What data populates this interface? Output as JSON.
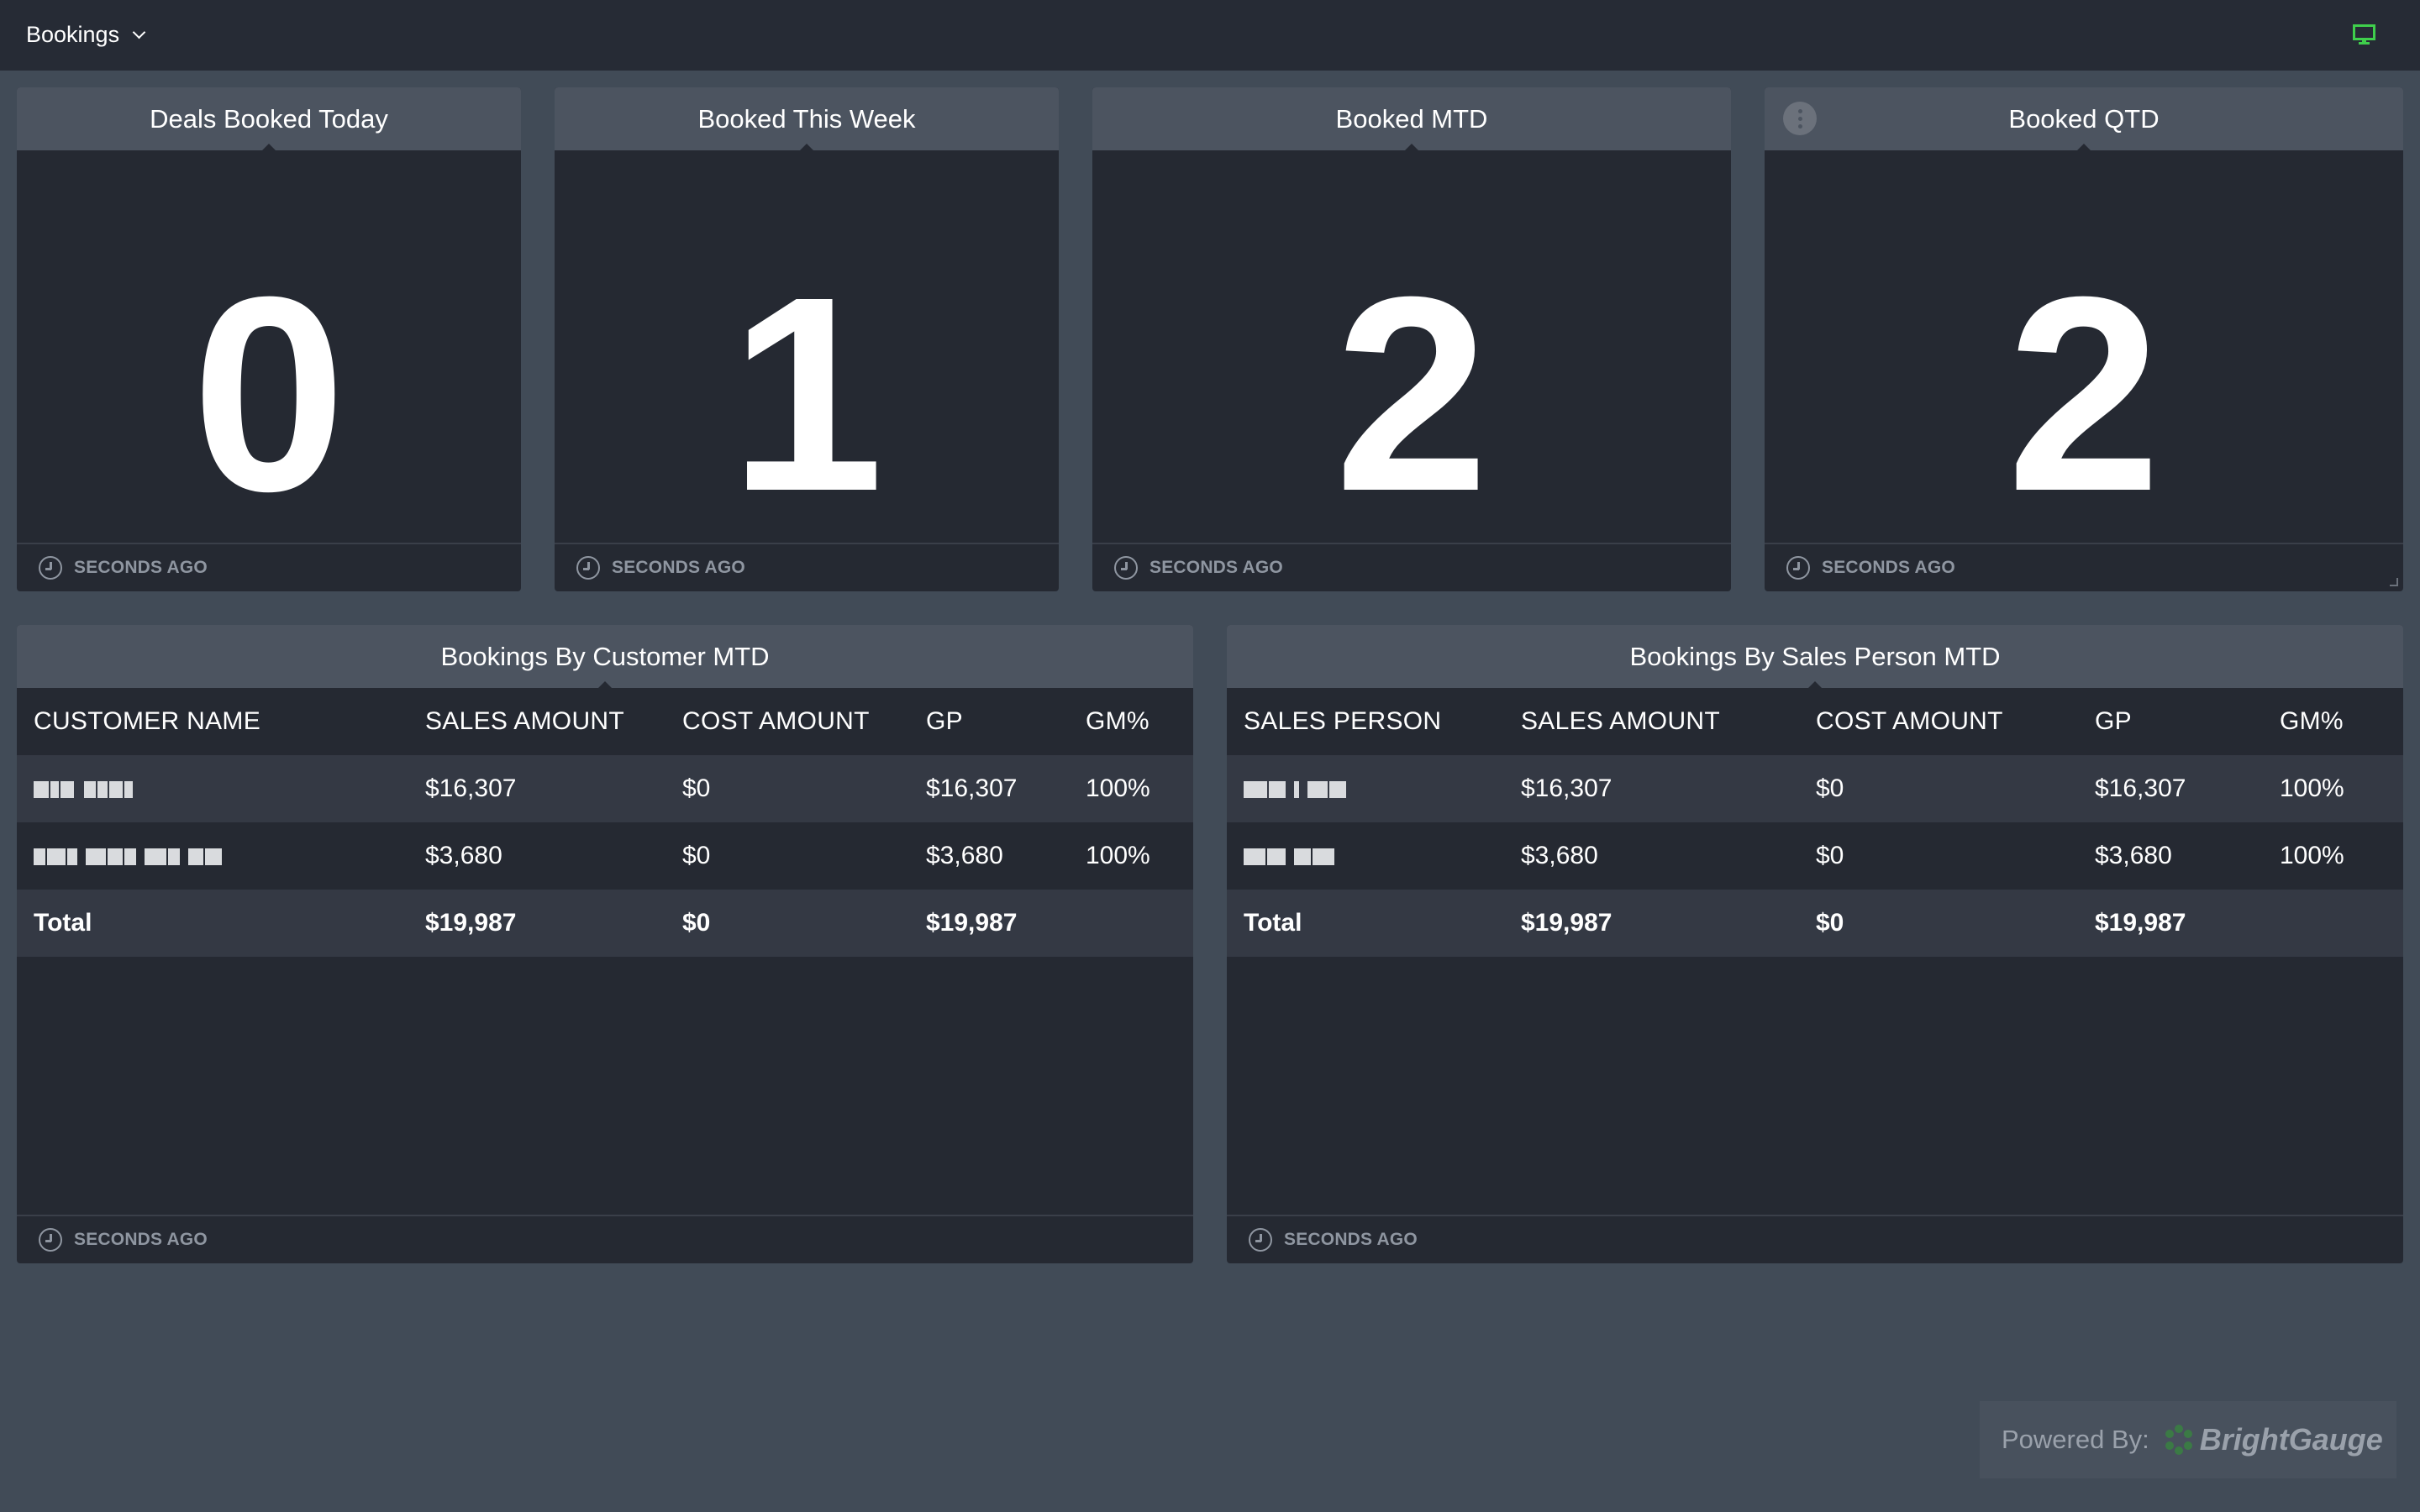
{
  "topbar": {
    "title": "Bookings"
  },
  "colors": {
    "accent_green": "#3fcf4c",
    "header_bg": "#4c5460",
    "panel_bg": "#252932",
    "page_bg": "#414b57"
  },
  "icons": {
    "monitor": "monitor-icon",
    "clock": "clock-icon",
    "kebab": "kebab-menu-icon",
    "logo": "brightgauge-logo-icon"
  },
  "widgets": [
    {
      "title": "Deals Booked Today",
      "value": "0",
      "updated": "SECONDS AGO"
    },
    {
      "title": "Booked This Week",
      "value": "1",
      "updated": "SECONDS AGO"
    },
    {
      "title": "Booked MTD",
      "value": "2",
      "updated": "SECONDS AGO"
    },
    {
      "title": "Booked QTD",
      "value": "2",
      "updated": "SECONDS AGO"
    }
  ],
  "customer_table": {
    "title": "Bookings By Customer MTD",
    "columns": [
      "CUSTOMER NAME",
      "SALES AMOUNT",
      "COST AMOUNT",
      "GP",
      "GM%"
    ],
    "rows": [
      {
        "sales": "$16,307",
        "cost": "$0",
        "gp": "$16,307",
        "gm": "100%"
      },
      {
        "sales": "$3,680",
        "cost": "$0",
        "gp": "$3,680",
        "gm": "100%"
      }
    ],
    "total": {
      "label": "Total",
      "sales": "$19,987",
      "cost": "$0",
      "gp": "$19,987"
    },
    "updated": "SECONDS AGO"
  },
  "sales_table": {
    "title": "Bookings By Sales Person MTD",
    "columns": [
      "SALES PERSON",
      "SALES AMOUNT",
      "COST AMOUNT",
      "GP",
      "GM%"
    ],
    "rows": [
      {
        "sales": "$16,307",
        "cost": "$0",
        "gp": "$16,307",
        "gm": "100%"
      },
      {
        "sales": "$3,680",
        "cost": "$0",
        "gp": "$3,680",
        "gm": "100%"
      }
    ],
    "total": {
      "label": "Total",
      "sales": "$19,987",
      "cost": "$0",
      "gp": "$19,987"
    },
    "updated": "SECONDS AGO"
  },
  "footer": {
    "powered_by": "Powered By:",
    "brand": "BrightGauge"
  }
}
